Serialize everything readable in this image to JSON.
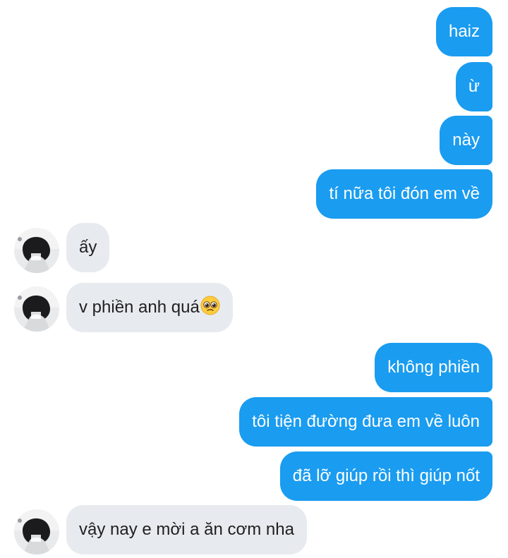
{
  "chat": {
    "messages": [
      {
        "id": "m1",
        "from": "me",
        "text": "haiz"
      },
      {
        "id": "m2",
        "from": "me",
        "text": "ừ"
      },
      {
        "id": "m3",
        "from": "me",
        "text": "này"
      },
      {
        "id": "m4",
        "from": "me",
        "text": "tí nữa tôi đón em về"
      },
      {
        "id": "m5",
        "from": "other",
        "text": "ấy"
      },
      {
        "id": "m6",
        "from": "other",
        "text": "v phiền anh quá",
        "emoji": "pleading-face-icon"
      },
      {
        "id": "m7",
        "from": "me",
        "text": "không phiền"
      },
      {
        "id": "m8",
        "from": "me",
        "text": "tôi tiện đường đưa em về luôn"
      },
      {
        "id": "m9",
        "from": "me",
        "text": "đã lỡ giúp rồi thì giúp nốt"
      },
      {
        "id": "m10",
        "from": "other",
        "text": "vậy nay e mời a ăn cơm nha"
      }
    ]
  },
  "colors": {
    "sent_bubble": "#1a9cf0",
    "received_bubble": "#e7ebef",
    "sent_text": "#ffffff",
    "received_text": "#1f1f1f"
  }
}
